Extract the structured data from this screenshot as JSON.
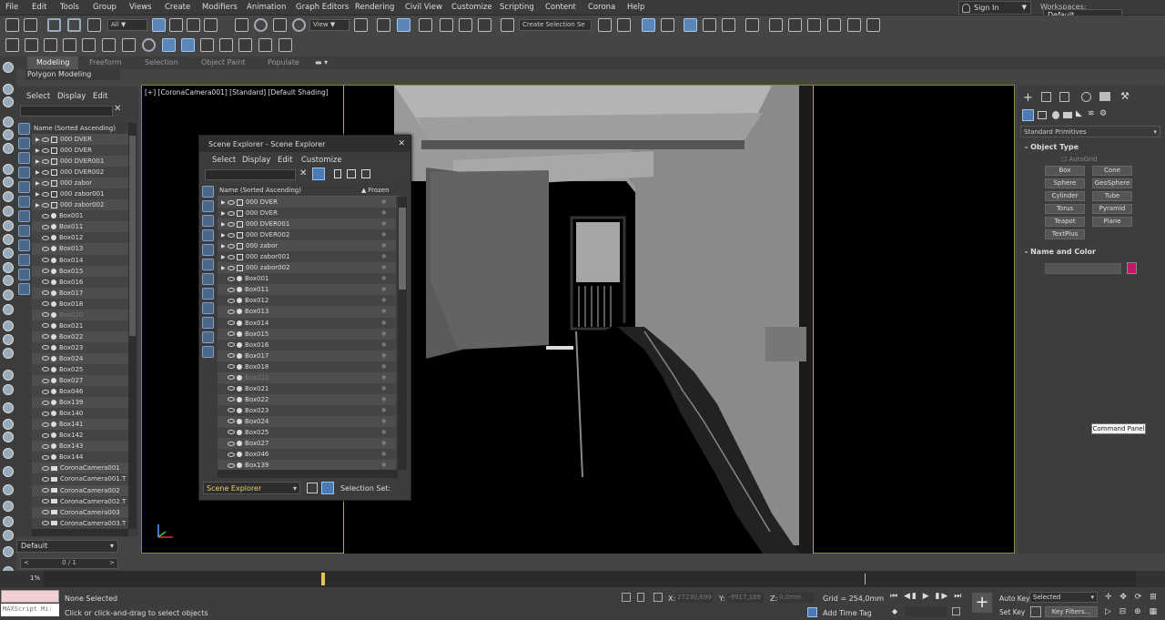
{
  "menu": [
    "File",
    "Edit",
    "Tools",
    "Group",
    "Views",
    "Create",
    "Modifiers",
    "Animation",
    "Graph Editors",
    "Rendering",
    "Civil View",
    "Customize",
    "Scripting",
    "Content",
    "Corona",
    "Help"
  ],
  "account": {
    "signin": "Sign In",
    "workspaces_label": "Workspaces:",
    "workspace": "Default"
  },
  "toolbar": {
    "filter": "All",
    "refcoord": "View",
    "selection_set": "Create Selection Se"
  },
  "ribbon": {
    "tabs": [
      "Modeling",
      "Freeform",
      "Selection",
      "Object Paint",
      "Populate"
    ],
    "active": "Modeling",
    "sub": "Polygon Modeling"
  },
  "explorer_left": {
    "menu": [
      "Select",
      "Display",
      "Edit"
    ],
    "column": "Name (Sorted Ascending)",
    "items": [
      "000 DVER",
      "000 DVER",
      "000 DVER001",
      "000 DVER002",
      "000 zabor",
      "000 zabor001",
      "000 zabor002",
      "Box001",
      "Box011",
      "Box012",
      "Box013",
      "Box014",
      "Box015",
      "Box016",
      "Box017",
      "Box018",
      "Box020",
      "Box021",
      "Box022",
      "Box023",
      "Box024",
      "Box025",
      "Box027",
      "Box046",
      "Box139",
      "Box140",
      "Box141",
      "Box142",
      "Box143",
      "Box144",
      "CoronaCamera001",
      "CoronaCamera001.T",
      "CoronaCamera002",
      "CoronaCamera002.T",
      "CoronaCamera003",
      "CoronaCamera003.T"
    ],
    "layer": "Default",
    "pager": "0 / 1"
  },
  "viewport": {
    "label": "[+] [CoronaCamera001] [Standard] [Default Shading]"
  },
  "scene_explorer": {
    "title": "Scene Explorer - Scene Explorer",
    "menu": [
      "Select",
      "Display",
      "Edit",
      "Customize"
    ],
    "col_name": "Name (Sorted Ascending)",
    "col_frozen": "▲ Frozen",
    "items": [
      "000 DVER",
      "000 DVER",
      "000 DVER001",
      "000 DVER002",
      "000 zabor",
      "000 zabor001",
      "000 zabor002",
      "Box001",
      "Box011",
      "Box012",
      "Box013",
      "Box014",
      "Box015",
      "Box016",
      "Box017",
      "Box018",
      "Box020",
      "Box021",
      "Box022",
      "Box023",
      "Box024",
      "Box025",
      "Box027",
      "Box046",
      "Box139"
    ],
    "footer_name": "Scene Explorer",
    "footer_label": "Selection Set:"
  },
  "command_panel": {
    "dropdown": "Standard Primitives",
    "object_type": "Object Type",
    "autogrid": "AutoGrid",
    "buttons": [
      "Box",
      "Cone",
      "Sphere",
      "GeoSphere",
      "Cylinder",
      "Tube",
      "Torus",
      "Pyramid",
      "Teapot",
      "Plane",
      "TextPlus"
    ],
    "name_and_color": "Name and Color",
    "color": "#c2186b",
    "tooltip": "Command Panel"
  },
  "timeline": {
    "frame_label": "1%"
  },
  "status": {
    "script": "MAXScript Mi:",
    "selected": "None Selected",
    "hint": "Click or click-and-drag to select objects",
    "x_label": "X:",
    "x_val": "27230,699",
    "y_label": "Y:",
    "y_val": "-9917,189",
    "z_label": "Z:",
    "z_val": "0,0mm",
    "grid": "Grid = 254,0mm",
    "add_time_tag": "Add Time Tag",
    "auto_key": "Auto Key",
    "selected_dd": "Selected",
    "set_key": "Set Key",
    "key_filters": "Key Filters..."
  }
}
